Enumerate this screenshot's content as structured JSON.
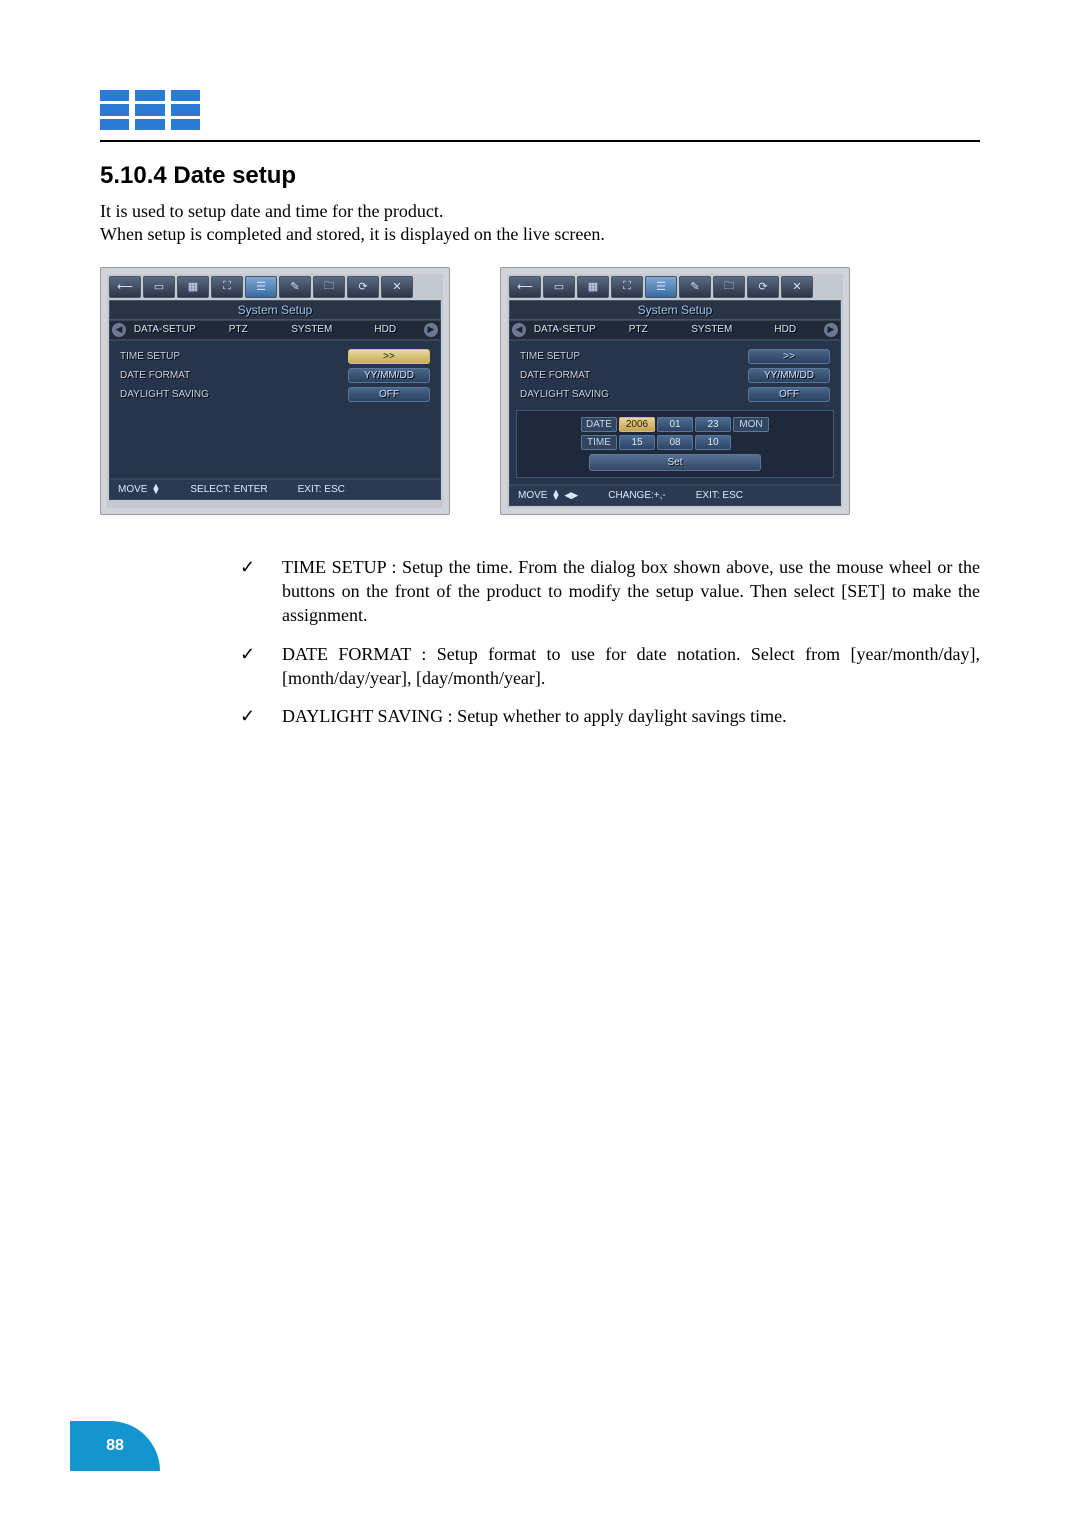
{
  "section": {
    "heading": "5.10.4 Date setup",
    "intro_line1": "It is used to setup date and time for the product.",
    "intro_line2": "When setup is completed and stored, it is displayed on the live screen."
  },
  "screenshots": {
    "title": "System Setup",
    "tabs": {
      "t1": "DATA-SETUP",
      "t2": "PTZ",
      "t3": "SYSTEM",
      "t4": "HDD"
    },
    "left": {
      "row1_label": "TIME SETUP",
      "row1_value": ">>",
      "row2_label": "DATE FORMAT",
      "row2_value": "YY/MM/DD",
      "row3_label": "DAYLIGHT SAVING",
      "row3_value": "OFF",
      "footer_move": "MOVE",
      "footer_select": "SELECT: ENTER",
      "footer_exit": "EXIT: ESC"
    },
    "right": {
      "row1_label": "TIME SETUP",
      "row1_value": ">>",
      "row2_label": "DATE FORMAT",
      "row2_value": "YY/MM/DD",
      "row3_label": "DAYLIGHT SAVING",
      "row3_value": "OFF",
      "date_tag": "DATE",
      "date_y": "2006",
      "date_m": "01",
      "date_d": "23",
      "date_dow": "MON",
      "time_tag": "TIME",
      "time_h": "15",
      "time_min": "08",
      "time_s": "10",
      "set_btn": "Set",
      "footer_move": "MOVE",
      "footer_change": "CHANGE:+,-",
      "footer_exit": "EXIT: ESC"
    }
  },
  "bullets": {
    "b1": "TIME SETUP : Setup the time. From the dialog box shown above, use the mouse wheel or the buttons on the front of the product to modify the setup value. Then select [SET] to make the assignment.",
    "b2": "DATE FORMAT : Setup format to use for date notation. Select from [year/month/day], [month/day/year], [day/month/year].",
    "b3": "DAYLIGHT SAVING : Setup whether to apply daylight savings time."
  },
  "page_number": "88"
}
